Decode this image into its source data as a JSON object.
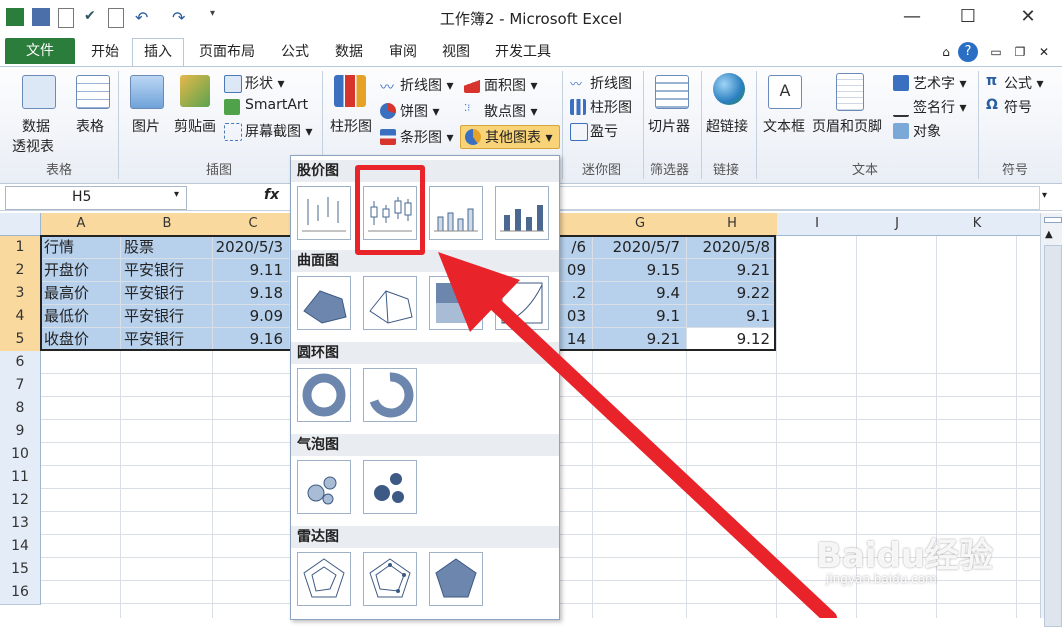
{
  "window": {
    "title": "工作簿2 - Microsoft Excel",
    "minimize": "—",
    "maximize": "☐",
    "close": "✕"
  },
  "tabs": [
    "文件",
    "开始",
    "插入",
    "页面布局",
    "公式",
    "数据",
    "审阅",
    "视图",
    "开发工具"
  ],
  "ribbon": {
    "groups": {
      "tables": "表格",
      "illustrations": "插图",
      "sparklines": "迷你图",
      "filter": "筛选器",
      "links": "链接",
      "text": "文本",
      "symbols": "符号"
    },
    "pivot1": "数据",
    "pivot2": "透视表",
    "table": "表格",
    "picture": "图片",
    "clipart": "剪贴画",
    "shapes": "形状",
    "smartart": "SmartArt",
    "screenshot": "屏幕截图",
    "column_chart": "柱形图",
    "line_chart": "折线图",
    "pie_chart": "饼图",
    "bar_chart": "条形图",
    "area_chart": "面积图",
    "scatter_chart": "散点图",
    "other_charts": "其他图表",
    "spark_line": "折线图",
    "spark_column": "柱形图",
    "spark_winloss": "盈亏",
    "slicer": "切片器",
    "hyperlink": "超链接",
    "textbox": "文本框",
    "header_footer": "页眉和页脚",
    "wordart": "艺术字",
    "signature": "签名行",
    "object": "对象",
    "equation": "公式",
    "symbol": "符号"
  },
  "formula_bar": {
    "name_box": "H5",
    "fx": "fx"
  },
  "sheet": {
    "columns": [
      "A",
      "B",
      "C",
      "G",
      "H",
      "I",
      "J",
      "K"
    ],
    "rows": [
      "1",
      "2",
      "3",
      "4",
      "5",
      "6",
      "7",
      "8",
      "9",
      "10",
      "11",
      "12",
      "13",
      "14",
      "15",
      "16"
    ],
    "row1": [
      "行情",
      "股票",
      "2020/5/3",
      "/6",
      "2020/5/7",
      "2020/5/8"
    ],
    "row2": [
      "开盘价",
      "平安银行",
      "9.11",
      "09",
      "9.15",
      "9.21"
    ],
    "row3": [
      "最高价",
      "平安银行",
      "9.18",
      ".2",
      "9.4",
      "9.22"
    ],
    "row4": [
      "最低价",
      "平安银行",
      "9.09",
      "03",
      "9.1",
      "9.1"
    ],
    "row5": [
      "收盘价",
      "平安银行",
      "9.16",
      "14",
      "9.21",
      "9.12"
    ]
  },
  "dropdown": {
    "stock": "股价图",
    "surface": "曲面图",
    "doughnut": "圆环图",
    "bubble": "气泡图",
    "radar": "雷达图"
  },
  "watermark": "Baidu经验",
  "watermark_url": "jingyan.baidu.com",
  "colors": {
    "file_tab": "#2a7d3a",
    "selection": "#b7d0ec",
    "highlight_box": "#e8232a",
    "arrow": "#e8232a"
  }
}
